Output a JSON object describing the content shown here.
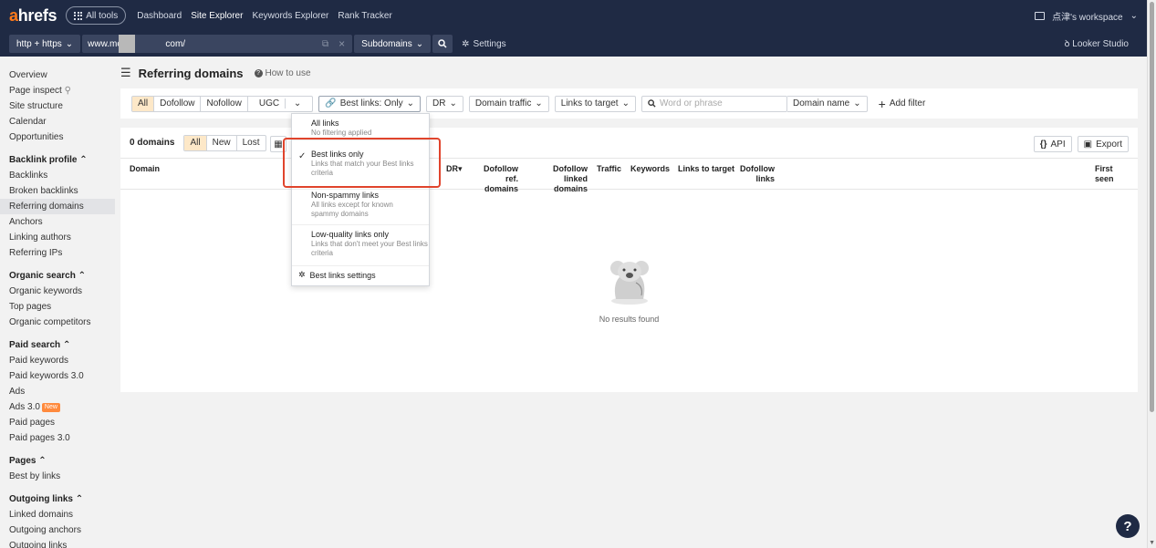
{
  "topnav": {
    "logo_a": "a",
    "logo_rest": "hrefs",
    "all_tools": "All tools",
    "links": [
      "Dashboard",
      "Site Explorer",
      "Keywords Explorer",
      "Rank Tracker"
    ],
    "workspace": "点津's workspace",
    "workspace_chevron": "⌄"
  },
  "searchrow": {
    "protocol": "http + https",
    "url_prefix": "www.mc",
    "url_suffix": "com/",
    "subdomains": "Subdomains",
    "settings": "Settings",
    "looker": "Looker Studio"
  },
  "sidebar": {
    "top_items": [
      "Overview",
      "Page inspect",
      "Site structure",
      "Calendar",
      "Opportunities"
    ],
    "sections": [
      {
        "title": "Backlink profile",
        "items": [
          "Backlinks",
          "Broken backlinks",
          "Referring domains",
          "Anchors",
          "Linking authors",
          "Referring IPs"
        ]
      },
      {
        "title": "Organic search",
        "items": [
          "Organic keywords",
          "Top pages",
          "Organic competitors"
        ]
      },
      {
        "title": "Paid search",
        "items": [
          "Paid keywords",
          "Paid keywords 3.0",
          "Ads",
          "Ads 3.0",
          "Paid pages",
          "Paid pages 3.0"
        ]
      },
      {
        "title": "Pages",
        "items": [
          "Best by links"
        ]
      },
      {
        "title": "Outgoing links",
        "items": [
          "Linked domains",
          "Outgoing anchors",
          "Outgoing links"
        ]
      }
    ],
    "new_badge": "New",
    "active": "Referring domains"
  },
  "page": {
    "title": "Referring domains",
    "how_to": "How to use"
  },
  "filters": {
    "link_types": [
      "All",
      "Dofollow",
      "Nofollow",
      "UGC"
    ],
    "best_links": "Best links: Only",
    "dr": "DR",
    "domain_traffic": "Domain traffic",
    "links_to_target": "Links to target",
    "word_placeholder": "Word or phrase",
    "domain_name": "Domain name",
    "add_filter": "Add filter"
  },
  "table": {
    "count": "0 domains",
    "tabs": [
      "All",
      "New",
      "Lost"
    ],
    "api": "API",
    "export": "Export",
    "columns": {
      "domain": "Domain",
      "dr": "DR",
      "dofollow_ref_1": "Dofollow ref.",
      "dofollow_ref_2": "domains",
      "dofollow_linked_1": "Dofollow linked",
      "dofollow_linked_2": "domains",
      "traffic": "Traffic",
      "keywords": "Keywords",
      "links_to_target": "Links to target",
      "dofollow_links_1": "Dofollow",
      "dofollow_links_2": "links",
      "first_seen_1": "First",
      "first_seen_2": "seen"
    },
    "empty": "No results found"
  },
  "dropdown": {
    "options": [
      {
        "title": "All links",
        "desc": "No filtering applied"
      },
      {
        "title": "Best links only",
        "desc": "Links that match your Best links criteria"
      },
      {
        "title": "Non-spammy links",
        "desc": "All links except for known spammy domains"
      },
      {
        "title": "Low-quality links only",
        "desc": "Links that don't meet your Best links criteria"
      }
    ],
    "settings": "Best links settings",
    "selected": "Best links only"
  },
  "colors": {
    "nav_bg": "#1f2a44",
    "accent_orange": "#ff7a1a",
    "selected_bg": "#fde8c8",
    "highlight": "#e0442c"
  }
}
